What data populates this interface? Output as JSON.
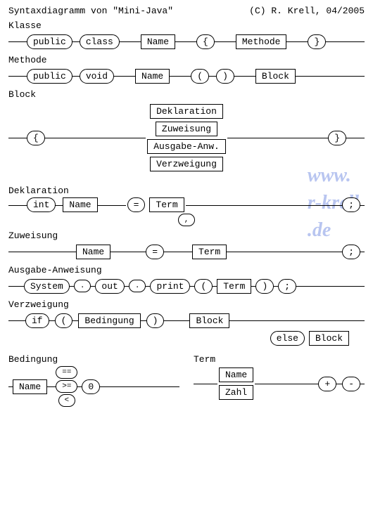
{
  "header": {
    "title": "Syntaxdiagramm von \"Mini-Java\"",
    "copyright": "(C) R. Krell, 04/2005"
  },
  "watermark": {
    "line1": "www.",
    "line2": "r-krell",
    "line3": ".de"
  },
  "klasse": {
    "label": "Klasse",
    "t_public": "public",
    "t_class": "class",
    "n_name": "Name",
    "t_lbrace": "{",
    "n_methode": "Methode",
    "t_rbrace": "}"
  },
  "methode": {
    "label": "Methode",
    "t_public": "public",
    "t_void": "void",
    "n_name": "Name",
    "t_lpar": "(",
    "t_rpar": ")",
    "n_block": "Block"
  },
  "block": {
    "label": "Block",
    "t_lbrace": "{",
    "t_rbrace": "}",
    "n_dekl": "Deklaration",
    "n_zuw": "Zuweisung",
    "n_ausg": "Ausgabe-Anw.",
    "n_verzw": "Verzweigung"
  },
  "deklaration": {
    "label": "Deklaration",
    "t_int": "int",
    "n_name": "Name",
    "t_eq": "=",
    "n_term": "Term",
    "t_comma": ",",
    "t_semi": ";"
  },
  "zuweisung": {
    "label": "Zuweisung",
    "n_name": "Name",
    "t_eq": "=",
    "n_term": "Term",
    "t_semi": ";"
  },
  "ausgabe": {
    "label": "Ausgabe-Anweisung",
    "t_system": "System",
    "t_dot1": ".",
    "t_out": "out",
    "t_dot2": ".",
    "t_print": "print",
    "t_lpar": "(",
    "n_term": "Term",
    "t_rpar": ")",
    "t_semi": ";"
  },
  "verzweigung": {
    "label": "Verzweigung",
    "t_if": "if",
    "t_lpar": "(",
    "n_bed": "Bedingung",
    "t_rpar": ")",
    "n_block1": "Block",
    "t_else": "else",
    "n_block2": "Block"
  },
  "bedingung": {
    "label": "Bedingung",
    "n_name": "Name",
    "op_eq": "==",
    "op_ge": ">=",
    "op_lt": "<",
    "t_zero": "0"
  },
  "term": {
    "label": "Term",
    "n_name": "Name",
    "n_zahl": "Zahl",
    "op_plus": "+",
    "op_minus": "-"
  }
}
